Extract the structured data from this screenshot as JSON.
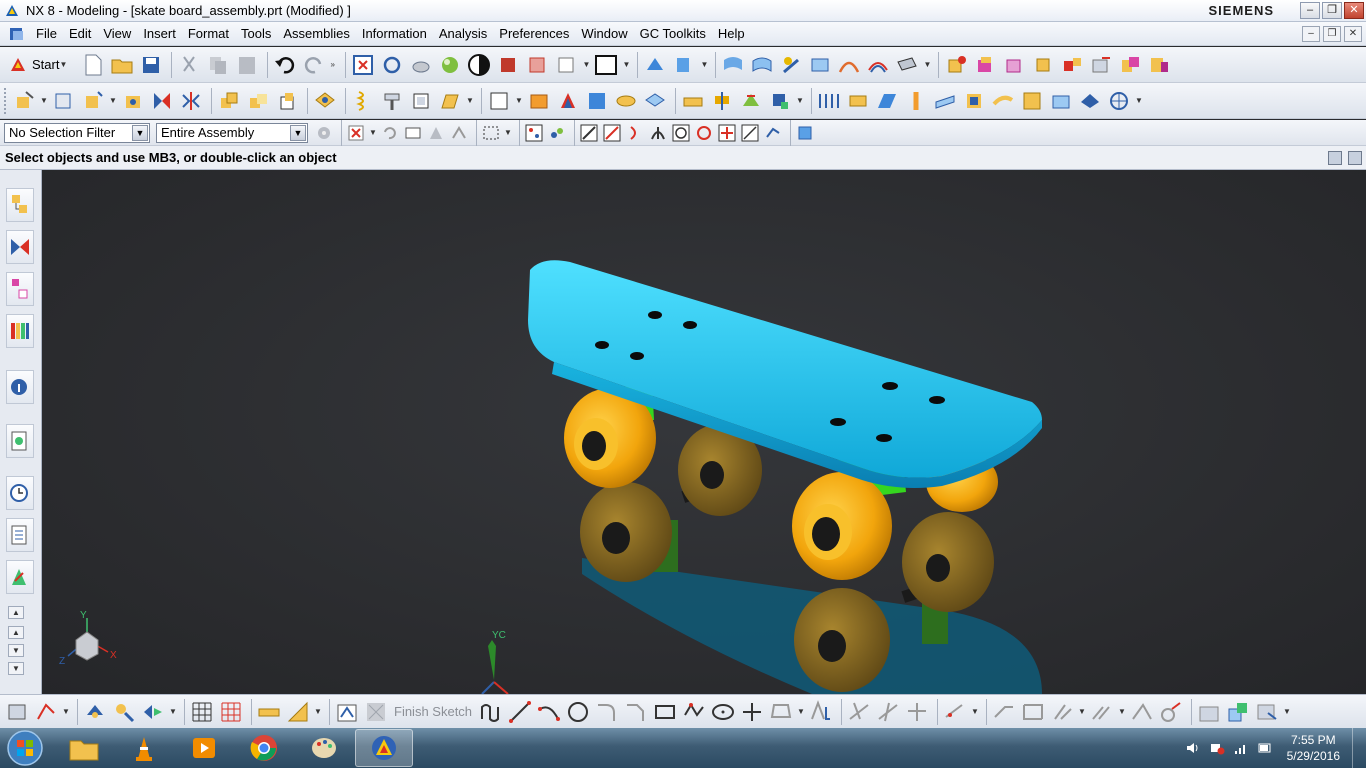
{
  "window": {
    "title": "NX 8 - Modeling - [skate board_assembly.prt (Modified) ]",
    "brand": "SIEMENS"
  },
  "menu": {
    "items": [
      "File",
      "Edit",
      "View",
      "Insert",
      "Format",
      "Tools",
      "Assemblies",
      "Information",
      "Analysis",
      "Preferences",
      "Window",
      "GC Toolkits",
      "Help"
    ]
  },
  "toolbar": {
    "start_label": "Start"
  },
  "selection": {
    "filter_value": "No Selection Filter",
    "scope_value": "Entire Assembly"
  },
  "cue": {
    "text": "Select objects and use MB3, or double-click an object"
  },
  "viewport": {
    "triad_x": "X",
    "triad_y": "Y",
    "triad_z": "Z",
    "wcs_yc": "YC"
  },
  "sketch": {
    "finish_label": "Finish Sketch"
  },
  "taskbar": {
    "time": "7:55 PM",
    "date": "5/29/2016"
  },
  "colors": {
    "deck": "#1ec8ec",
    "wheel": "#f2a50c",
    "truck": "#35d61f",
    "background": "#2a2b2e"
  }
}
